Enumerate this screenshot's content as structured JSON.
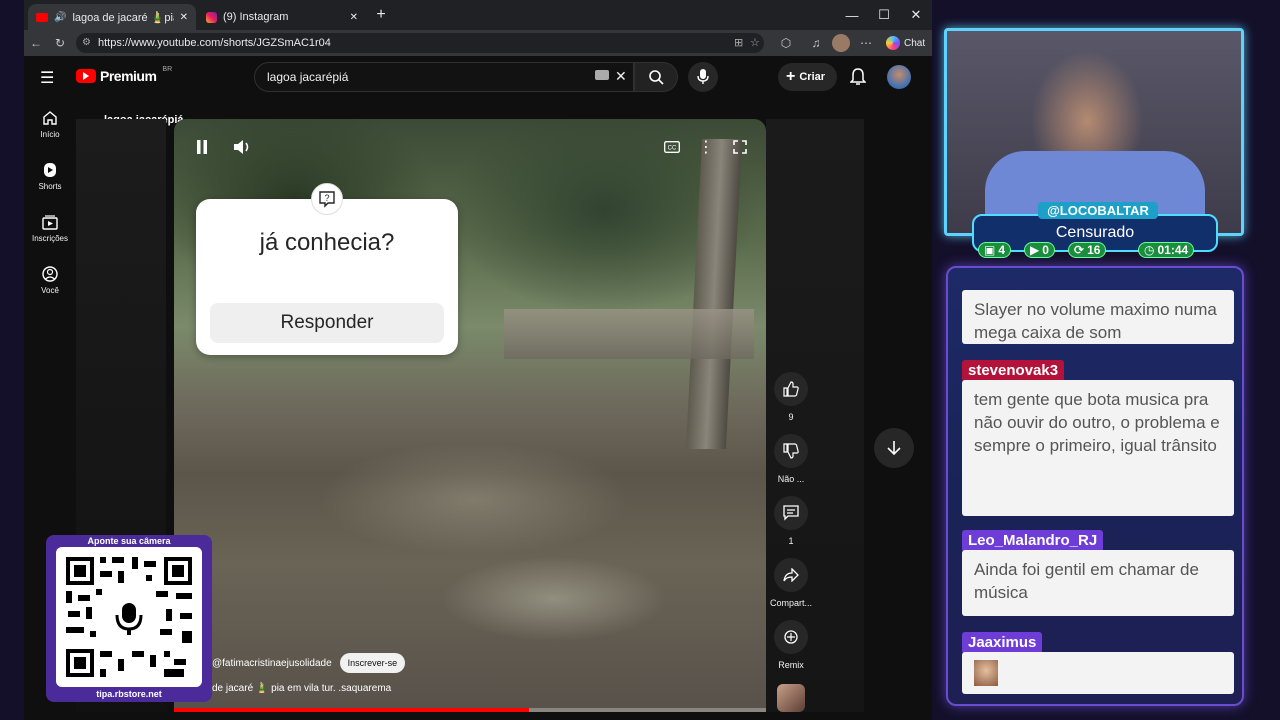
{
  "browser": {
    "tabs": [
      {
        "title": "lagoa de jacaré 🎍pia em vila",
        "favicon": "youtube-icon",
        "active": true
      },
      {
        "title": "(9) Instagram",
        "favicon": "instagram-icon",
        "active": false
      }
    ],
    "new_tab_label": "+",
    "window": {
      "minimize": "—",
      "maximize": "☐",
      "close": "✕"
    },
    "url": "https://www.youtube.com/shorts/JGZSmAC1r04",
    "chat_label": "Chat"
  },
  "youtube": {
    "logo_text": "Premium",
    "region": "BR",
    "search_query": "lagoa jacarépiá",
    "create_label": "Criar",
    "sidebar": [
      {
        "label": "Início",
        "icon": "home-icon"
      },
      {
        "label": "Shorts",
        "icon": "shorts-icon"
      },
      {
        "label": "Inscrições",
        "icon": "subscriptions-icon"
      },
      {
        "label": "Você",
        "icon": "you-icon"
      }
    ],
    "back_label": "lagoa jacarépiá",
    "short": {
      "sticker_question": "já conhecia?",
      "sticker_button": "Responder",
      "channel": "@fatimacristinaejusolidade",
      "subscribe_label": "Inscrever-se",
      "title": "de jacaré 🎍 pia em vila tur. .saquarema",
      "progress": 0.6
    },
    "actions": {
      "like_count": "9",
      "dislike_label": "Não ...",
      "comments_count": "1",
      "share_label": "Compart...",
      "remix_label": "Remix"
    }
  },
  "overlay": {
    "streamer_handle": "@LOCOBALTAR",
    "status": "Censurado",
    "stats": {
      "twitch": "4",
      "youtube": "0",
      "kick": "16",
      "timer": "01:44"
    },
    "chat": [
      {
        "user": "",
        "text": "Slayer no volume maximo numa mega caixa de som"
      },
      {
        "user": "stevenovak3",
        "text": "tem gente que bota musica pra não ouvir do outro, o problema e sempre o primeiro, igual trânsito"
      },
      {
        "user": "Leo_Malandro_RJ",
        "text": "Ainda foi gentil em chamar de música"
      },
      {
        "user": "Jaaximus",
        "text": ""
      }
    ],
    "qr": {
      "top_text": "Aponte sua câmera",
      "bottom_text": "tipa.rbstore.net"
    }
  }
}
